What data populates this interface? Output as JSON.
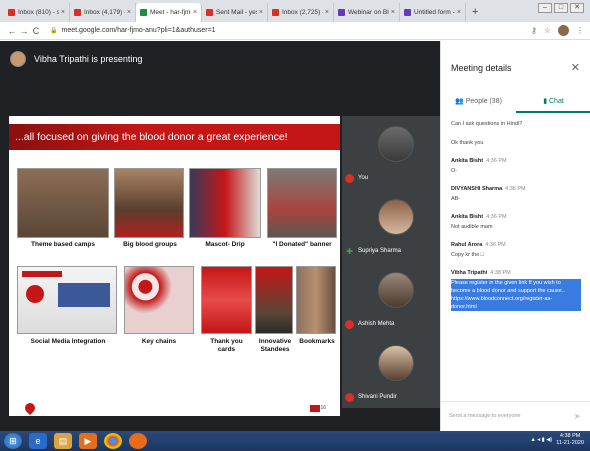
{
  "browser": {
    "tabs": [
      {
        "label": "Inbox (810) - shwe",
        "color": "#d93025",
        "active": false
      },
      {
        "label": "Inbox (4,179) - aba",
        "color": "#d93025",
        "active": false
      },
      {
        "label": "Meet - har-fjmo-",
        "color": "#1e8e3e",
        "active": true
      },
      {
        "label": "Sent Mail - yesdeo",
        "color": "#d93025",
        "active": false
      },
      {
        "label": "Inbox (2,725) - shu",
        "color": "#d93025",
        "active": false
      },
      {
        "label": "Webinar on Blood",
        "color": "#673ab7",
        "active": false
      },
      {
        "label": "Untitled form - Go",
        "color": "#673ab7",
        "active": false
      }
    ],
    "url": "meet.google.com/har-fjmo-anu?pli=1&authuser=1"
  },
  "meet": {
    "presenter_text": "Vibha Tripathi is presenting",
    "slide": {
      "header": "...all focused on giving the blood donor a great experience!",
      "captions": [
        "Theme based camps",
        "Big blood groups",
        "Mascot- Drip",
        "\"I Donated\" banner",
        "Social Media Integration",
        "Key chains",
        "Thank you cards",
        "Innovative Standees",
        "Bookmarks"
      ],
      "slide_number": "16"
    },
    "participants": [
      {
        "name": "You",
        "mic_on": false
      },
      {
        "name": "Supriya Sharma",
        "mic_on": true
      },
      {
        "name": "Ashish Mehta",
        "mic_on": false
      },
      {
        "name": "Shivani Pundir",
        "mic_on": false
      }
    ]
  },
  "panel": {
    "title": "Meeting details",
    "tabs": {
      "people": "People (38)",
      "chat": "Chat"
    },
    "messages": [
      {
        "who": "",
        "time": "",
        "lines": [
          "Can I ask questions in Hindi?"
        ]
      },
      {
        "who": "",
        "time": "",
        "lines": [
          "Ok thank you"
        ]
      },
      {
        "who": "Ankita Bisht",
        "time": "4:36 PM",
        "lines": [
          "O-"
        ]
      },
      {
        "who": "DIVYANSHI Sharma",
        "time": "4:36 PM",
        "lines": [
          "AB-"
        ]
      },
      {
        "who": "Ankita Bisht",
        "time": "4:36 PM",
        "lines": [
          "Not audible mam"
        ]
      },
      {
        "who": "Rahul Arora",
        "time": "4:36 PM",
        "lines": [
          "Copy kr the □"
        ]
      },
      {
        "who": "Vibha Tripathi",
        "time": "4:38 PM",
        "lines": [
          "Please register in the given link If you wish to",
          "become a blood donor and support the cause..",
          "https://www.bloodconnect.org/register-as-",
          "donor.html"
        ],
        "selected": true
      }
    ],
    "input_placeholder": "Send a message to everyone"
  },
  "taskbar": {
    "time": "4:38 PM",
    "date": "11-21-2020"
  }
}
